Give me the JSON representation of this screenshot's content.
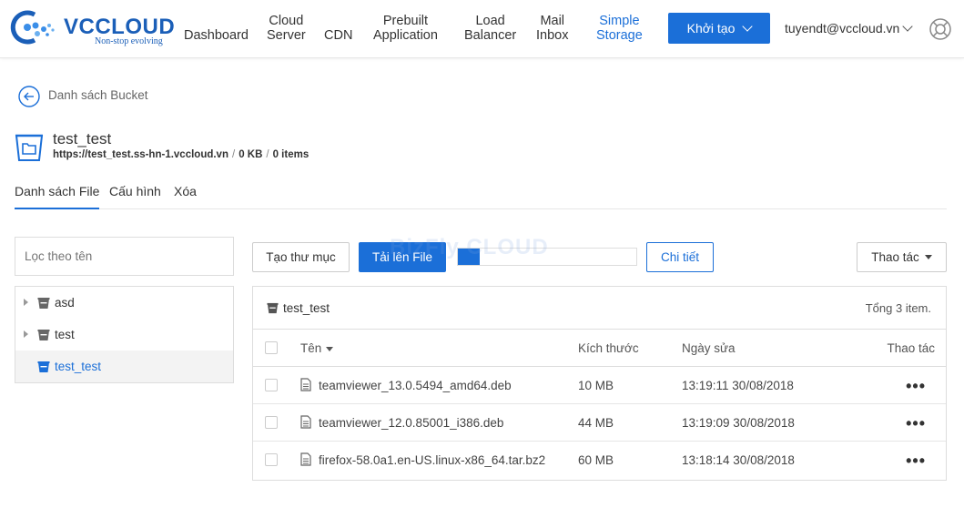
{
  "brand": {
    "name": "VCCLOUD",
    "tagline": "Non-stop evolving",
    "color": "#1b5fb8"
  },
  "nav": {
    "items": [
      {
        "label_l1": "Dashboard",
        "label_l2": ""
      },
      {
        "label_l1": "Cloud",
        "label_l2": "Server"
      },
      {
        "label_l1": "CDN",
        "label_l2": ""
      },
      {
        "label_l1": "Prebuilt",
        "label_l2": "Application"
      },
      {
        "label_l1": "Load",
        "label_l2": "Balancer"
      },
      {
        "label_l1": "Mail",
        "label_l2": "Inbox"
      },
      {
        "label_l1": "Simple",
        "label_l2": "Storage"
      }
    ],
    "active_index": 6,
    "create_label": "Khởi tạo",
    "user_email": "tuyendt@vccloud.vn"
  },
  "back": {
    "label": "Danh sách Bucket"
  },
  "bucket": {
    "name": "test_test",
    "url": "https://test_test.ss-hn-1.vccloud.vn",
    "size": "0 KB",
    "items": "0 items"
  },
  "tabs": [
    {
      "label": "Danh sách File",
      "active": true
    },
    {
      "label": "Cấu hình",
      "active": false
    },
    {
      "label": "Xóa",
      "active": false
    }
  ],
  "filter": {
    "placeholder": "Lọc theo tên"
  },
  "tree": [
    {
      "label": "asd",
      "selected": false,
      "has_caret": true
    },
    {
      "label": "test",
      "selected": false,
      "has_caret": true
    },
    {
      "label": "test_test",
      "selected": true,
      "has_caret": false
    }
  ],
  "toolbar": {
    "new_folder": "Tạo thư mục",
    "upload": "Tải lên File",
    "upload_progress": 0.12,
    "details": "Chi tiết",
    "actions": "Thao tác"
  },
  "watermark": "BizFly CLOUD",
  "panel": {
    "title": "test_test",
    "count": "Tổng 3 item.",
    "columns": {
      "name": "Tên",
      "size": "Kích thước",
      "date": "Ngày sửa",
      "actions": "Thao tác"
    },
    "rows": [
      {
        "name": "teamviewer_13.0.5494_amd64.deb",
        "size": "10 MB",
        "date": "13:19:11 30/08/2018"
      },
      {
        "name": "teamviewer_12.0.85001_i386.deb",
        "size": "44 MB",
        "date": "13:19:09 30/08/2018"
      },
      {
        "name": "firefox-58.0a1.en-US.linux-x86_64.tar.bz2",
        "size": "60 MB",
        "date": "13:18:14 30/08/2018"
      }
    ],
    "row_action_glyph": "•••"
  },
  "colors": {
    "accent": "#1b6fd8",
    "border": "#dddddd"
  }
}
